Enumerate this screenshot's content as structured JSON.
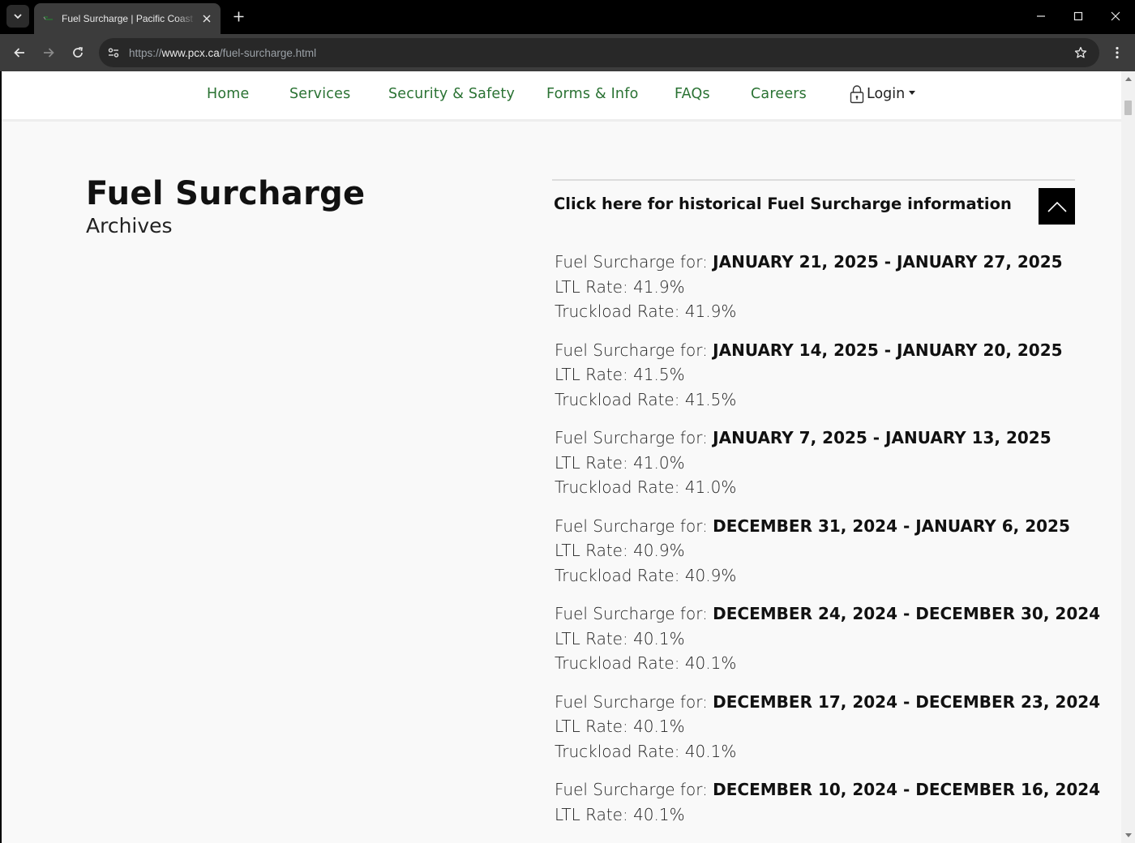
{
  "browser": {
    "tab_title": "Fuel Surcharge | Pacific Coast Express",
    "url_scheme": "https://",
    "url_host": "www.pcx.ca",
    "url_path": "/fuel-surcharge.html"
  },
  "nav": {
    "items": [
      "Home",
      "Services",
      "Security & Safety",
      "Forms & Info",
      "FAQs",
      "Careers"
    ],
    "login_label": "Login"
  },
  "page": {
    "title": "Fuel Surcharge",
    "subtitle": "Archives",
    "historical_link": "Click here for historical Fuel Surcharge information",
    "entry_prefix": "Fuel Surcharge for: ",
    "ltl_prefix": "LTL Rate: ",
    "truckload_prefix": "Truckload Rate: "
  },
  "entries": [
    {
      "dates": "JANUARY 21, 2025 - JANUARY 27, 2025",
      "ltl": "41.9%",
      "truckload": "41.9%"
    },
    {
      "dates": "JANUARY 14, 2025 - JANUARY 20, 2025",
      "ltl": "41.5%",
      "truckload": "41.5%"
    },
    {
      "dates": "JANUARY 7, 2025 - JANUARY 13, 2025",
      "ltl": "41.0%",
      "truckload": "41.0%"
    },
    {
      "dates": "DECEMBER 31, 2024 - JANUARY 6, 2025",
      "ltl": "40.9%",
      "truckload": "40.9%"
    },
    {
      "dates": "DECEMBER 24, 2024 - DECEMBER 30, 2024",
      "ltl": "40.1%",
      "truckload": "40.1%"
    },
    {
      "dates": "DECEMBER 17, 2024 - DECEMBER 23, 2024",
      "ltl": "40.1%",
      "truckload": "40.1%"
    },
    {
      "dates": "DECEMBER 10, 2024 - DECEMBER 16, 2024",
      "ltl": "40.1%",
      "truckload": ""
    }
  ],
  "colors": {
    "nav_link": "#2a7233",
    "background": "#f9f9f9",
    "chrome_dark": "#3c3c3c"
  }
}
